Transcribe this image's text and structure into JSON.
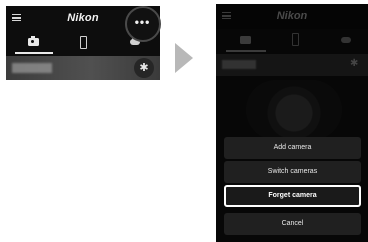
{
  "left_screen": {
    "brand": "Nikon",
    "more_button": "•••",
    "bluetooth_symbol": "✱",
    "tabs": [
      "camera-icon",
      "phone-icon",
      "cloud-icon"
    ]
  },
  "right_screen": {
    "brand": "Nikon",
    "menu": {
      "add": "Add camera",
      "switch": "Switch cameras",
      "forget": "Forget camera",
      "cancel": "Cancel"
    }
  },
  "colors": {
    "highlight_ring": "#4a4a4a",
    "arrow": "#b8b8b8",
    "selected_outline": "#ffffff"
  }
}
